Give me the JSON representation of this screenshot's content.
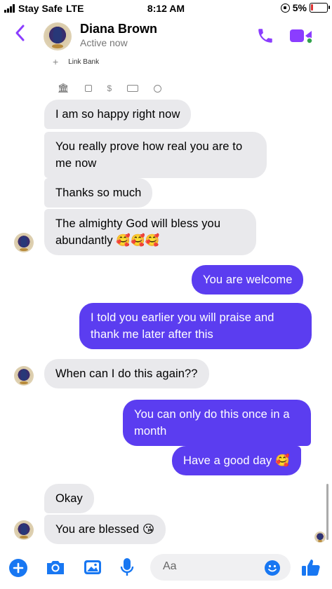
{
  "status_bar": {
    "carrier": "Stay Safe",
    "network": "LTE",
    "time": "8:12 AM",
    "battery": "5%"
  },
  "header": {
    "back_icon": "chevron-left-icon",
    "contact_name": "Diana Brown",
    "presence": "Active now",
    "accent_color": "#8b3dff"
  },
  "link_bank": {
    "label": "Link Bank"
  },
  "messages": [
    {
      "side": "in",
      "text": "I am so happy right now"
    },
    {
      "side": "in",
      "text": "You really prove how real you are to me now"
    },
    {
      "side": "in",
      "text": "Thanks so much"
    },
    {
      "side": "in",
      "text": "The almighty God will bless you abundantly 🥰🥰🥰"
    },
    {
      "side": "out",
      "text": "You are welcome"
    },
    {
      "side": "out",
      "text": "I told you earlier you will praise and thank me later after this"
    },
    {
      "side": "in",
      "text": "When can I do this again??"
    },
    {
      "side": "out",
      "text": "You can only do this once in a month"
    },
    {
      "side": "out",
      "text": "Have a good day 🥰"
    },
    {
      "side": "in",
      "text": "Okay"
    },
    {
      "side": "in",
      "text": "You are blessed 😘"
    }
  ],
  "composer": {
    "placeholder": "Aa",
    "accent_color": "#1877f2"
  }
}
